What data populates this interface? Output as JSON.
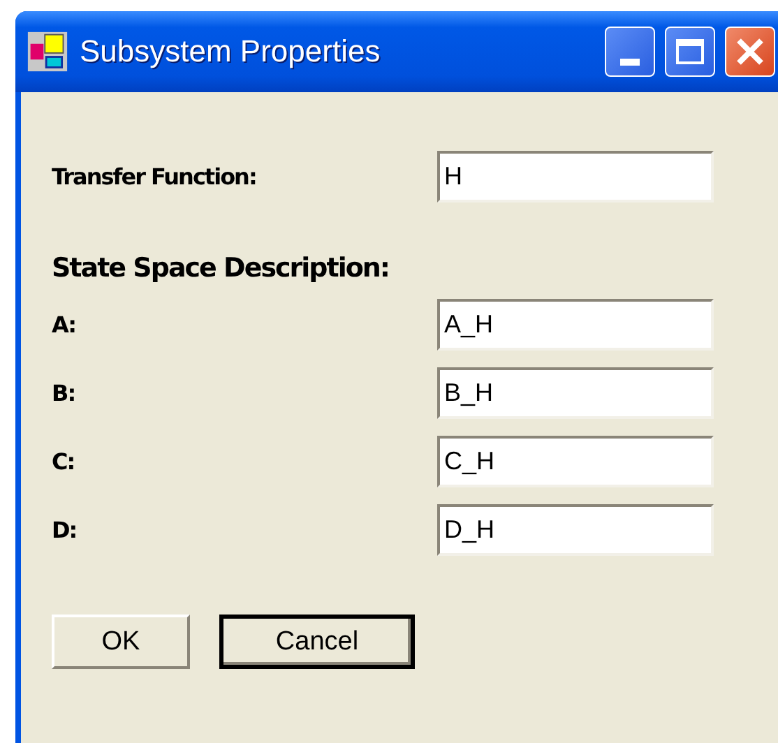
{
  "window": {
    "title": "Subsystem Properties"
  },
  "transfer_function": {
    "label": "Transfer Function:",
    "value": "H"
  },
  "state_space": {
    "heading": "State Space Description:",
    "fields": [
      {
        "label": "A:",
        "value": "A_H"
      },
      {
        "label": "B:",
        "value": "B_H"
      },
      {
        "label": "C:",
        "value": "C_H"
      },
      {
        "label": "D:",
        "value": "D_H"
      }
    ]
  },
  "buttons": [
    {
      "label": "OK",
      "default": false
    },
    {
      "label": "Cancel",
      "default": true
    }
  ]
}
